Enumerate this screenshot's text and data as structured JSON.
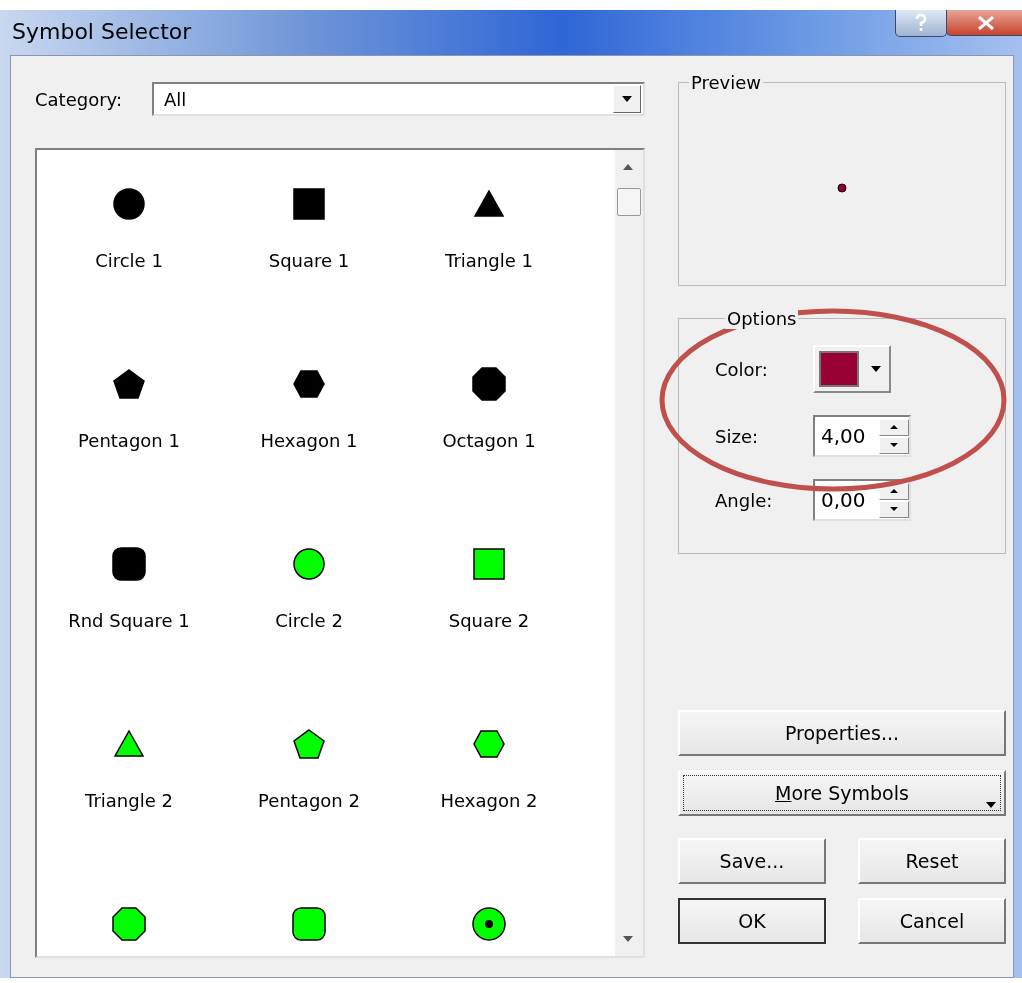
{
  "window": {
    "title": "Symbol Selector"
  },
  "category": {
    "label": "Category:",
    "value": "All"
  },
  "symbols": [
    {
      "label": "Circle 1",
      "kind": "circle",
      "color": "#000000"
    },
    {
      "label": "Square 1",
      "kind": "square",
      "color": "#000000"
    },
    {
      "label": "Triangle 1",
      "kind": "triangle",
      "color": "#000000"
    },
    {
      "label": "Pentagon 1",
      "kind": "pentagon",
      "color": "#000000"
    },
    {
      "label": "Hexagon 1",
      "kind": "hexagon",
      "color": "#000000"
    },
    {
      "label": "Octagon 1",
      "kind": "octagon",
      "color": "#000000"
    },
    {
      "label": "Rnd Square 1",
      "kind": "rounded-square",
      "color": "#000000"
    },
    {
      "label": "Circle 2",
      "kind": "circle",
      "color": "#00ff00"
    },
    {
      "label": "Square 2",
      "kind": "square",
      "color": "#00ff00"
    },
    {
      "label": "Triangle 2",
      "kind": "triangle",
      "color": "#00ff00"
    },
    {
      "label": "Pentagon 2",
      "kind": "pentagon",
      "color": "#00ff00"
    },
    {
      "label": "Hexagon 2",
      "kind": "hexagon",
      "color": "#00ff00"
    },
    {
      "kind": "octagon",
      "color": "#00ff00"
    },
    {
      "kind": "rounded-square",
      "color": "#00ff00"
    },
    {
      "kind": "circle-dot",
      "color": "#00ff00"
    }
  ],
  "preview": {
    "title": "Preview"
  },
  "options": {
    "title": "Options",
    "color": {
      "label": "Color:",
      "color": "#990033"
    },
    "size": {
      "label": "Size:",
      "value": "4,00"
    },
    "angle": {
      "label": "Angle:",
      "value": "0,00"
    }
  },
  "buttons": {
    "properties": "Properties...",
    "more_symbols": {
      "label": "More Symbols",
      "first_letter_underlined": true
    },
    "save": "Save...",
    "reset": "Reset",
    "ok": "OK",
    "cancel": "Cancel"
  }
}
